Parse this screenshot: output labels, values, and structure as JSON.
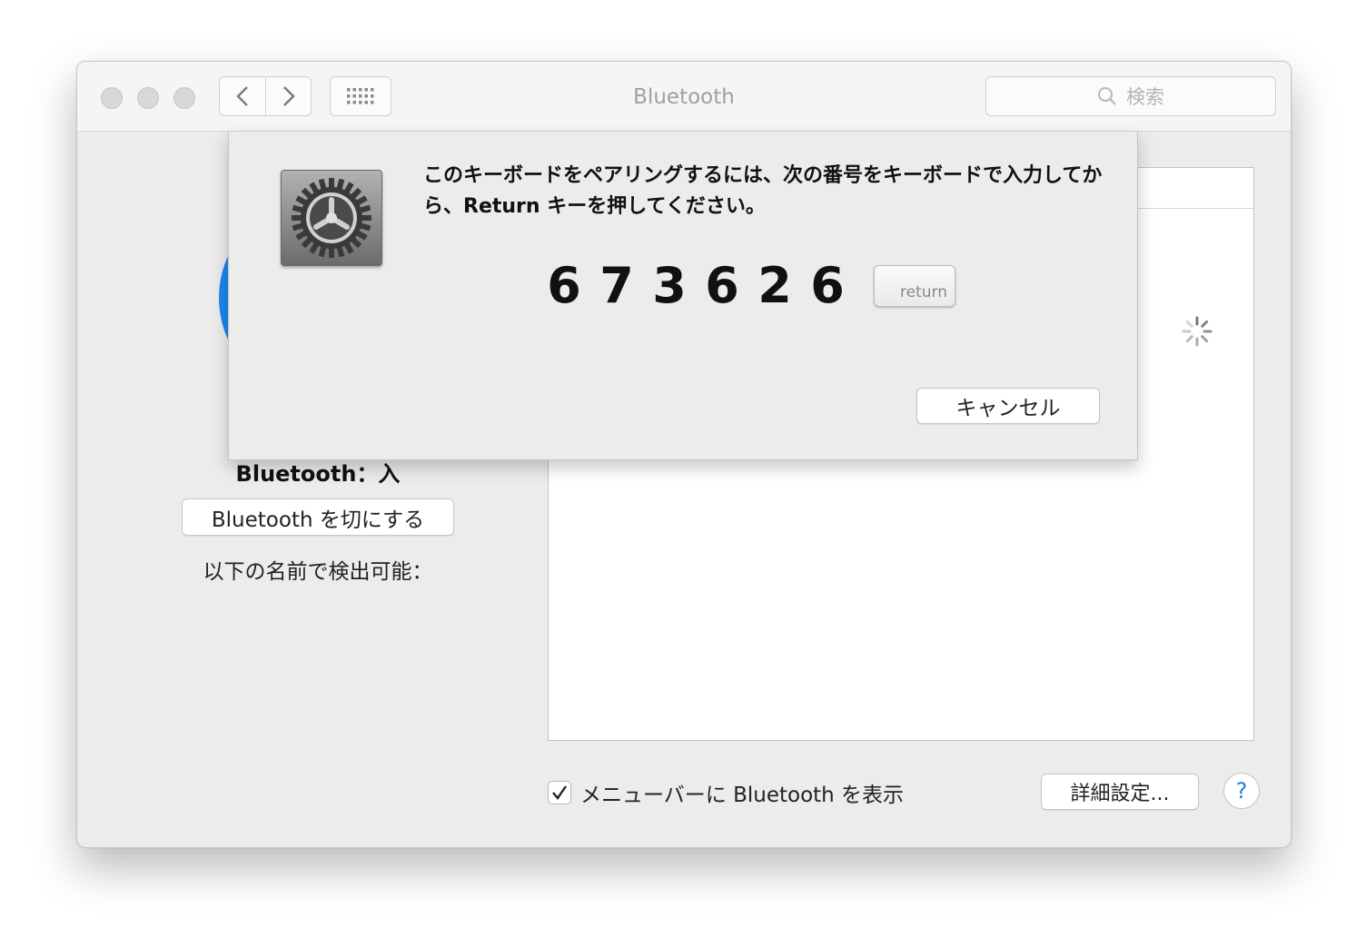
{
  "window": {
    "title": "Bluetooth",
    "search_placeholder": "検索"
  },
  "toolbar": {
    "icons": [
      "chevron-left-icon",
      "chevron-right-icon",
      "grid-icon",
      "search-icon"
    ]
  },
  "left_panel": {
    "status": "Bluetooth：入",
    "toggle_button": "Bluetooth を切にする",
    "discoverable_label": "以下の名前で検出可能："
  },
  "bottom": {
    "show_in_menubar_label": "メニューバーに Bluetooth を表示",
    "show_in_menubar_checked": true,
    "advanced_button": "詳細設定...",
    "help_button": "?"
  },
  "pairing_sheet": {
    "message": "このキーボードをペアリングするには、次の番号をキーボードで入力してから、Return キーを押してください。",
    "passkey_digits": [
      "6",
      "7",
      "3",
      "6",
      "2",
      "6"
    ],
    "return_key_label": "return",
    "cancel_button": "キャンセル"
  },
  "colors": {
    "bluetooth_blue": "#1e86f0",
    "help_blue": "#1a7ee8"
  }
}
